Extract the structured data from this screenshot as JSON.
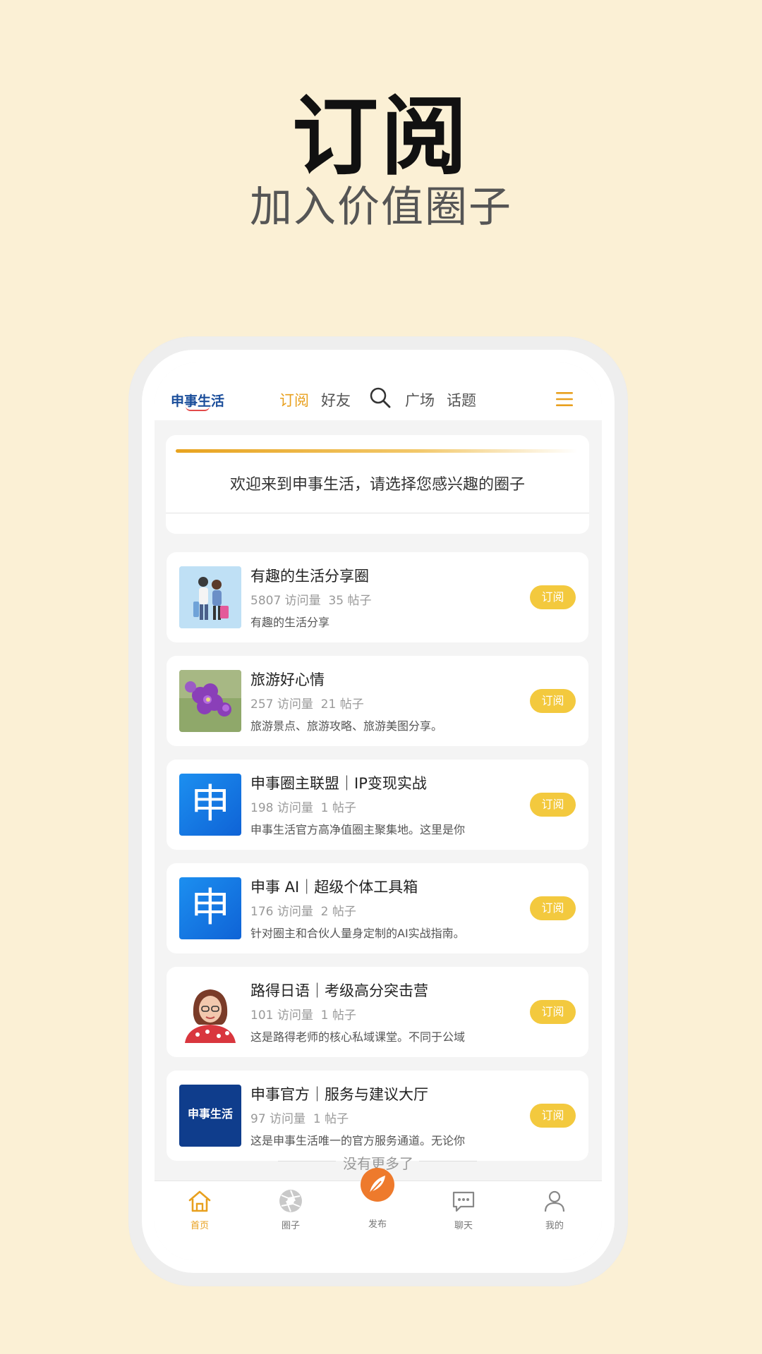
{
  "promo": {
    "title": "订阅",
    "subtitle": "加入价值圈子"
  },
  "app": {
    "logo_text": "申事生活",
    "nav_tabs": [
      "订阅",
      "好友",
      "广场",
      "话题"
    ],
    "active_tab": "订阅",
    "welcome_text": "欢迎来到申事生活，请选择您感兴趣的圈子",
    "circles": [
      {
        "title": "有趣的生活分享圈",
        "visits": "5807 访问量",
        "posts": "35 帖子",
        "desc": "有趣的生活分享",
        "button": "订阅",
        "thumb": "travel-couple-illustration"
      },
      {
        "title": "旅游好心情",
        "visits": "257 访问量",
        "posts": "21 帖子",
        "desc": "旅游景点、旅游攻略、旅游美图分享。",
        "button": "订阅",
        "thumb": "purple-flowers-photo"
      },
      {
        "title": "申事圈主联盟｜IP变现实战",
        "visits": "198 访问量",
        "posts": "1 帖子",
        "desc": "申事生活官方高净值圈主聚集地。这里是你",
        "button": "订阅",
        "thumb": "shen-logo-blue",
        "thumb_char": "申"
      },
      {
        "title": "申事 AI｜超级个体工具箱",
        "visits": "176 访问量",
        "posts": "2 帖子",
        "desc": "针对圈主和合伙人量身定制的AI实战指南。",
        "button": "订阅",
        "thumb": "shen-logo-blue",
        "thumb_char": "申"
      },
      {
        "title": "路得日语｜考级高分突击营",
        "visits": "101 访问量",
        "posts": "1 帖子",
        "desc": "这是路得老师的核心私域课堂。不同于公域",
        "button": "订阅",
        "thumb": "teacher-portrait"
      },
      {
        "title": "申事官方｜服务与建议大厅",
        "visits": "97 访问量",
        "posts": "1 帖子",
        "desc": "这是申事生活唯一的官方服务通道。无论你",
        "button": "订阅",
        "thumb": "shen-life-logo-navy",
        "thumb_text": "申事生活"
      }
    ],
    "no_more_text": "没有更多了",
    "tabbar": {
      "home": "首页",
      "circle": "圈子",
      "publish": "发布",
      "chat": "聊天",
      "mine": "我的",
      "active": "首页"
    },
    "colors": {
      "accent": "#E8A01E",
      "subscribe_button": "#F3C93E",
      "background": "#FBF0D5"
    }
  }
}
